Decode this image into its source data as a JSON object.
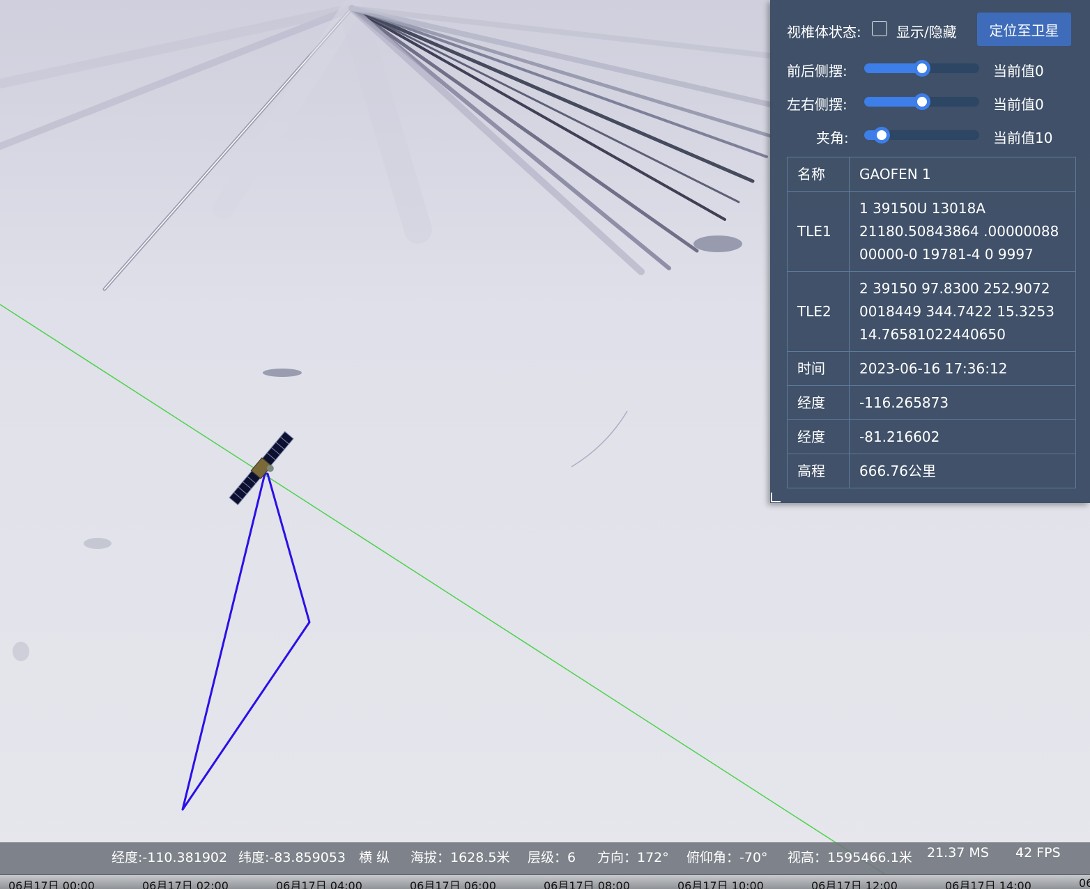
{
  "panel": {
    "frustum_label": "视椎体状态:",
    "checkbox_label": "显示/隐藏",
    "checkbox_checked": false,
    "locate_button": "定位至卫星",
    "sliders": [
      {
        "label": "前后侧摆:",
        "value_text": "当前值0",
        "level": 0.5
      },
      {
        "label": "左右侧摆:",
        "value_text": "当前值0",
        "level": 0.5
      },
      {
        "label": "夹角:",
        "value_text": "当前值10",
        "level": 0.15
      }
    ],
    "info": [
      {
        "key": "名称",
        "value": "GAOFEN 1"
      },
      {
        "key": "TLE1",
        "value": "1 39150U 13018A 21180.50843864 .00000088 00000-0 19781-4 0 9997"
      },
      {
        "key": "TLE2",
        "value": "2 39150 97.8300 252.9072 0018449 344.7422 15.3253 14.76581022440650"
      },
      {
        "key": "时间",
        "value": "2023-06-16 17:36:12"
      },
      {
        "key": "经度",
        "value": "-116.265873"
      },
      {
        "key": "经度",
        "value": "-81.216602"
      },
      {
        "key": "高程",
        "value": "666.76公里"
      }
    ]
  },
  "status": {
    "lon": "经度:-110.381902",
    "lat": "纬度:-83.859053",
    "mode": "横 纵",
    "altitude": "海拔：1628.5米",
    "level": "层级：6",
    "heading": "方向：172°",
    "pitch": "俯仰角：-70°",
    "view_height": "视高：1595466.1米",
    "ms": "21.37 MS",
    "fps": "42 FPS"
  },
  "timeline": {
    "ticks": [
      "06月17日 00:00",
      "06月17日 02:00",
      "06月17日 04:00",
      "06月17日 06:00",
      "06月17日 08:00",
      "06月17日 10:00",
      "06月17日 12:00",
      "06月17日 14:00",
      "06"
    ]
  },
  "colors": {
    "ground_track": "#4cd34c",
    "sensor_cone": "#2b10e8",
    "panel_bg": "#34465f",
    "button": "#3e6cba",
    "slider_fill": "#3d7ee8"
  }
}
